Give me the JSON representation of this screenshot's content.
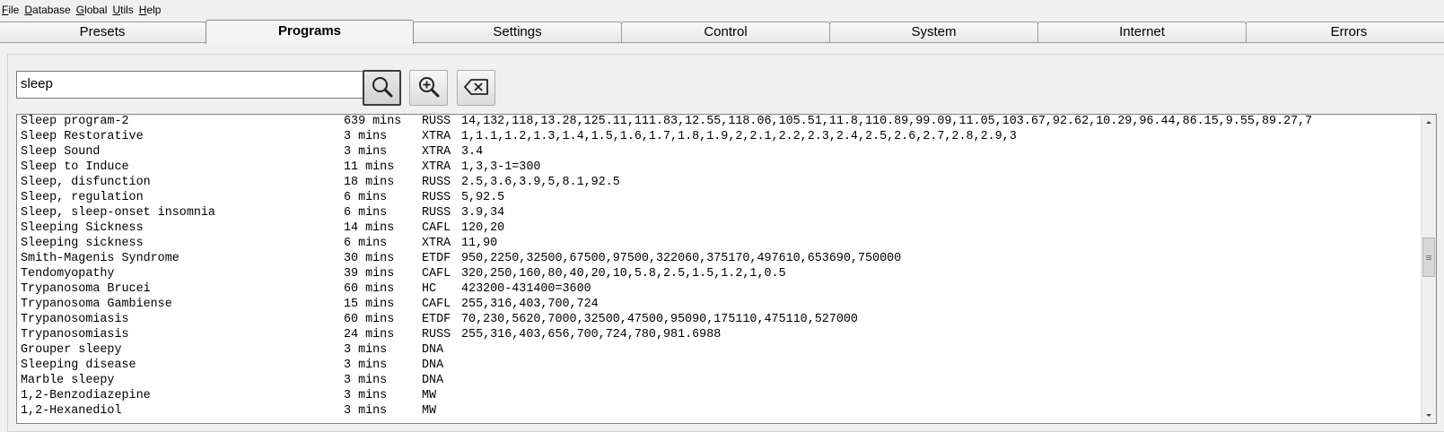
{
  "menu": {
    "items": [
      {
        "mnemonic": "F",
        "rest": "ile"
      },
      {
        "mnemonic": "D",
        "rest": "atabase"
      },
      {
        "mnemonic": "G",
        "rest": "lobal"
      },
      {
        "mnemonic": "U",
        "rest": "tils"
      },
      {
        "mnemonic": "H",
        "rest": "elp"
      }
    ]
  },
  "tabs": [
    {
      "label": "Presets",
      "active": false
    },
    {
      "label": "Programs",
      "active": true
    },
    {
      "label": "Settings",
      "active": false
    },
    {
      "label": "Control",
      "active": false
    },
    {
      "label": "System",
      "active": false
    },
    {
      "label": "Internet",
      "active": false
    },
    {
      "label": "Errors",
      "active": false
    }
  ],
  "search": {
    "value": "sleep",
    "buttons": [
      {
        "icon": "search-icon",
        "pressed": true
      },
      {
        "icon": "zoom-in-icon",
        "pressed": false
      },
      {
        "icon": "clear-backspace-icon",
        "pressed": false
      }
    ]
  },
  "results": [
    {
      "name": "Sleep program-2",
      "duration": "639 mins",
      "type": "RUSS",
      "frequencies": "14,132,118,13.28,125.11,111.83,12.55,118.06,105.51,11.8,110.89,99.09,11.05,103.67,92.62,10.29,96.44,86.15,9.55,89.27,7"
    },
    {
      "name": "Sleep Restorative",
      "duration": "3 mins",
      "type": "XTRA",
      "frequencies": "1,1.1,1.2,1.3,1.4,1.5,1.6,1.7,1.8,1.9,2,2.1,2.2,2.3,2.4,2.5,2.6,2.7,2.8,2.9,3"
    },
    {
      "name": "Sleep Sound",
      "duration": "3 mins",
      "type": "XTRA",
      "frequencies": "3.4"
    },
    {
      "name": "Sleep to Induce",
      "duration": "11 mins",
      "type": "XTRA",
      "frequencies": "1,3,3-1=300"
    },
    {
      "name": "Sleep, disfunction",
      "duration": "18 mins",
      "type": "RUSS",
      "frequencies": "2.5,3.6,3.9,5,8.1,92.5"
    },
    {
      "name": "Sleep, regulation",
      "duration": "6 mins",
      "type": "RUSS",
      "frequencies": "5,92.5"
    },
    {
      "name": "Sleep, sleep-onset insomnia",
      "duration": "6 mins",
      "type": "RUSS",
      "frequencies": "3.9,34"
    },
    {
      "name": "Sleeping Sickness",
      "duration": "14 mins",
      "type": "CAFL",
      "frequencies": "120,20"
    },
    {
      "name": "Sleeping sickness",
      "duration": "6 mins",
      "type": "XTRA",
      "frequencies": "11,90"
    },
    {
      "name": "Smith-Magenis Syndrome",
      "duration": "30 mins",
      "type": "ETDF",
      "frequencies": "950,2250,32500,67500,97500,322060,375170,497610,653690,750000"
    },
    {
      "name": "Tendomyopathy",
      "duration": "39 mins",
      "type": "CAFL",
      "frequencies": "320,250,160,80,40,20,10,5.8,2.5,1.5,1.2,1,0.5"
    },
    {
      "name": "Trypanosoma Brucei",
      "duration": "60 mins",
      "type": "HC",
      "frequencies": "423200-431400=3600"
    },
    {
      "name": "Trypanosoma Gambiense",
      "duration": "15 mins",
      "type": "CAFL",
      "frequencies": "255,316,403,700,724"
    },
    {
      "name": "Trypanosomiasis",
      "duration": "60 mins",
      "type": "ETDF",
      "frequencies": "70,230,5620,7000,32500,47500,95090,175110,475110,527000"
    },
    {
      "name": "Trypanosomiasis",
      "duration": "24 mins",
      "type": "RUSS",
      "frequencies": "255,316,403,656,700,724,780,981.6988"
    },
    {
      "name": "Grouper sleepy",
      "duration": "3 mins",
      "type": "DNA",
      "frequencies": ""
    },
    {
      "name": "Sleeping disease",
      "duration": "3 mins",
      "type": "DNA",
      "frequencies": ""
    },
    {
      "name": "Marble sleepy",
      "duration": "3 mins",
      "type": "DNA",
      "frequencies": ""
    },
    {
      "name": "1,2-Benzodiazepine",
      "duration": "3 mins",
      "type": "MW",
      "frequencies": ""
    },
    {
      "name": "1,2-Hexanediol",
      "duration": "3 mins",
      "type": "MW",
      "frequencies": ""
    }
  ],
  "scroll": {
    "position": 0.45
  }
}
